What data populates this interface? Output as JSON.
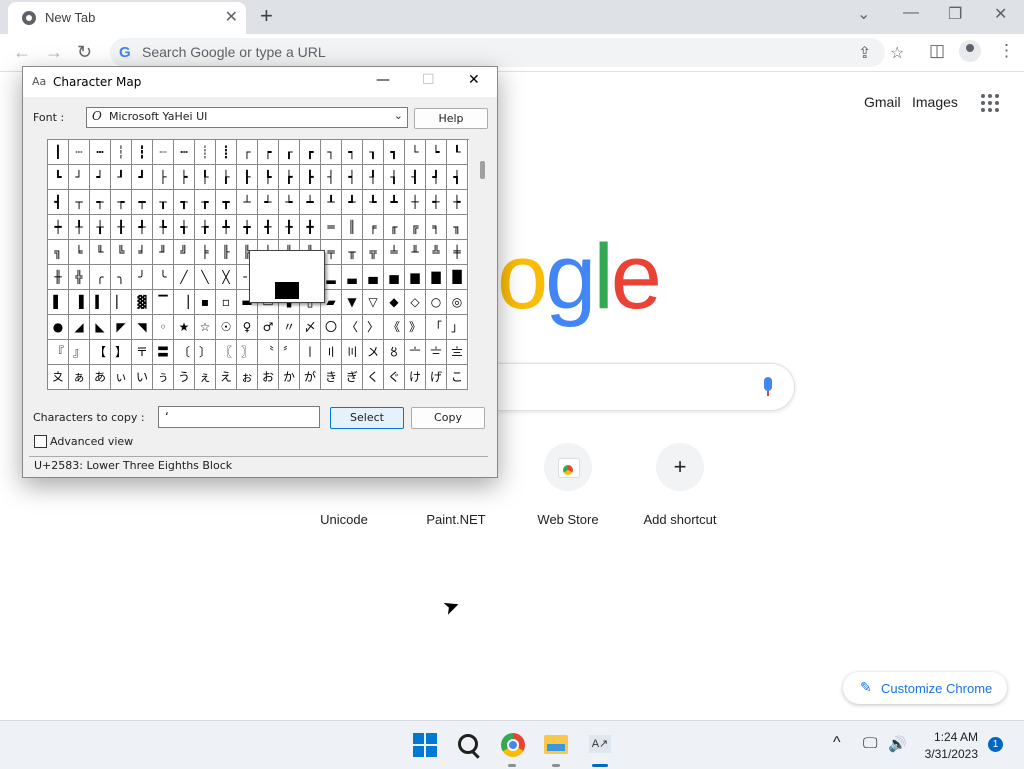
{
  "browser": {
    "tab_title": "New Tab",
    "tab_close": "✕",
    "new_tab": "+",
    "window_controls": {
      "dropdown": "⌄",
      "minimize": "—",
      "restore": "❐",
      "close": "✕"
    },
    "nav": {
      "back": "←",
      "forward": "→",
      "reload": "↻"
    },
    "omnibox_placeholder": "Search Google or type a URL",
    "omnibox_g": "G",
    "omni_share": "⇪",
    "omni_star": "☆",
    "sidepanel": "◫",
    "menu": "⋮"
  },
  "google": {
    "links": [
      "Gmail",
      "Images"
    ],
    "logo_visible": "ogle",
    "shortcuts": [
      {
        "label": "Unicode"
      },
      {
        "label": "Paint.NET"
      },
      {
        "label": "Web Store"
      },
      {
        "label": "Add shortcut",
        "glyph": "+"
      }
    ],
    "customize_label": "Customize Chrome",
    "customize_icon": "✎",
    "cursor": "➤"
  },
  "charmap": {
    "title": "Character Map",
    "icon": "Aa",
    "controls": {
      "minimize": "—",
      "maximize": "☐",
      "close": "✕"
    },
    "font_label": "Font :",
    "font_icon": "O",
    "font_name": "Microsoft YaHei UI",
    "font_chevron": "⌄",
    "help_label": "Help",
    "grid": [
      [
        "┃",
        "┄",
        "┅",
        "┆",
        "┇",
        "┈",
        "┉",
        "┊",
        "┋",
        "┌",
        "┍",
        "┎",
        "┏",
        "┐",
        "┑",
        "┒",
        "┓",
        "└",
        "┕",
        "┖"
      ],
      [
        "┗",
        "┘",
        "┙",
        "┚",
        "┛",
        "├",
        "┝",
        "┞",
        "┟",
        "┠",
        "┡",
        "┢",
        "┣",
        "┤",
        "┥",
        "┦",
        "┧",
        "┨",
        "┩",
        "┪"
      ],
      [
        "┫",
        "┬",
        "┭",
        "┮",
        "┯",
        "┰",
        "┱",
        "┲",
        "┳",
        "┴",
        "┵",
        "┶",
        "┷",
        "┸",
        "┹",
        "┺",
        "┻",
        "┼",
        "┽",
        "┾"
      ],
      [
        "┿",
        "╀",
        "╁",
        "╂",
        "╃",
        "╄",
        "╅",
        "╆",
        "╇",
        "╈",
        "╉",
        "╊",
        "╋",
        "═",
        "║",
        "╒",
        "╓",
        "╔",
        "╕",
        "╖"
      ],
      [
        "╗",
        "╘",
        "╙",
        "╚",
        "╛",
        "╜",
        "╝",
        "╞",
        "╟",
        "╠",
        "╡",
        "╢",
        "╣",
        "╤",
        "╥",
        "╦",
        "╧",
        "╨",
        "╩",
        "╪"
      ],
      [
        "╫",
        "╬",
        "╭",
        "╮",
        "╯",
        "╰",
        "╱",
        "╲",
        "╳",
        "╴",
        "╵",
        "╶",
        "▁",
        "▂",
        "▃",
        "▄",
        "▅",
        "▆",
        "▇",
        "█"
      ],
      [
        "▌",
        "▐",
        "▍",
        "▏",
        "▓",
        "▔",
        "▕",
        "▪",
        "▫",
        "▬",
        "▭",
        "▮",
        "▯",
        "▰",
        "▼",
        "▽",
        "◆",
        "◇",
        "○",
        "◎"
      ],
      [
        "●",
        "◢",
        "◣",
        "◤",
        "◥",
        "◦",
        "★",
        "☆",
        "☉",
        "♀",
        "♂",
        "〃",
        "〆",
        "〇",
        "〈",
        "〉",
        "《",
        "》",
        "「",
        "」"
      ],
      [
        "『",
        "』",
        "【",
        "】",
        "〒",
        "〓",
        "〔",
        "〕",
        "〖",
        "〗",
        "〝",
        "〞",
        "〡",
        "〢",
        "〣",
        "〤",
        "〥",
        "〦",
        "〧",
        "〨"
      ],
      [
        "〩",
        "ぁ",
        "あ",
        "ぃ",
        "い",
        "ぅ",
        "う",
        "ぇ",
        "え",
        "ぉ",
        "お",
        "か",
        "が",
        "き",
        "ぎ",
        "く",
        "ぐ",
        "け",
        "げ",
        "こ"
      ]
    ],
    "ctc_label": "Characters to copy :",
    "ctc_value": "ʻ",
    "select_label": "Select",
    "copy_label": "Copy",
    "advanced_label": "Advanced view",
    "status": "U+2583: Lower Three Eighths Block"
  },
  "taskbar": {
    "charmap_icon": "A↗",
    "tray_chevron": "^",
    "tray_network": "🖵",
    "tray_volume": "🔊",
    "time": "1:24 AM",
    "date": "3/31/2023",
    "notifications": "1"
  }
}
